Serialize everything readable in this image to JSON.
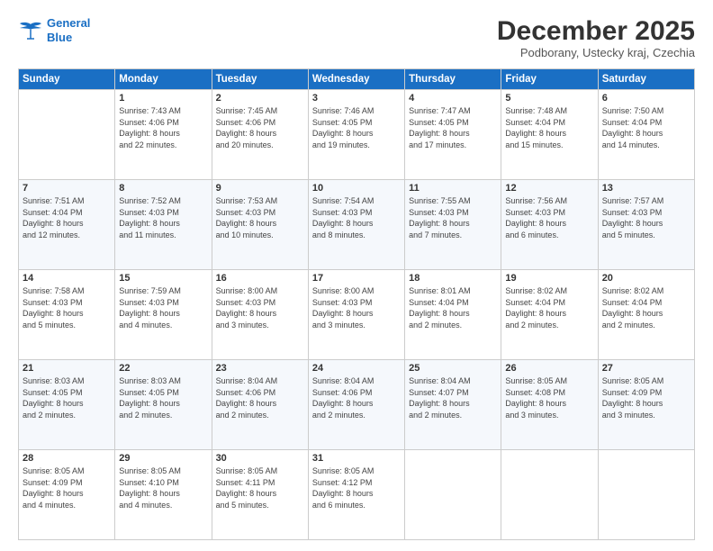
{
  "header": {
    "logo_line1": "General",
    "logo_line2": "Blue",
    "month": "December 2025",
    "location": "Podborany, Ustecky kraj, Czechia"
  },
  "days_of_week": [
    "Sunday",
    "Monday",
    "Tuesday",
    "Wednesday",
    "Thursday",
    "Friday",
    "Saturday"
  ],
  "weeks": [
    [
      {
        "day": "",
        "info": ""
      },
      {
        "day": "1",
        "info": "Sunrise: 7:43 AM\nSunset: 4:06 PM\nDaylight: 8 hours\nand 22 minutes."
      },
      {
        "day": "2",
        "info": "Sunrise: 7:45 AM\nSunset: 4:06 PM\nDaylight: 8 hours\nand 20 minutes."
      },
      {
        "day": "3",
        "info": "Sunrise: 7:46 AM\nSunset: 4:05 PM\nDaylight: 8 hours\nand 19 minutes."
      },
      {
        "day": "4",
        "info": "Sunrise: 7:47 AM\nSunset: 4:05 PM\nDaylight: 8 hours\nand 17 minutes."
      },
      {
        "day": "5",
        "info": "Sunrise: 7:48 AM\nSunset: 4:04 PM\nDaylight: 8 hours\nand 15 minutes."
      },
      {
        "day": "6",
        "info": "Sunrise: 7:50 AM\nSunset: 4:04 PM\nDaylight: 8 hours\nand 14 minutes."
      }
    ],
    [
      {
        "day": "7",
        "info": "Sunrise: 7:51 AM\nSunset: 4:04 PM\nDaylight: 8 hours\nand 12 minutes."
      },
      {
        "day": "8",
        "info": "Sunrise: 7:52 AM\nSunset: 4:03 PM\nDaylight: 8 hours\nand 11 minutes."
      },
      {
        "day": "9",
        "info": "Sunrise: 7:53 AM\nSunset: 4:03 PM\nDaylight: 8 hours\nand 10 minutes."
      },
      {
        "day": "10",
        "info": "Sunrise: 7:54 AM\nSunset: 4:03 PM\nDaylight: 8 hours\nand 8 minutes."
      },
      {
        "day": "11",
        "info": "Sunrise: 7:55 AM\nSunset: 4:03 PM\nDaylight: 8 hours\nand 7 minutes."
      },
      {
        "day": "12",
        "info": "Sunrise: 7:56 AM\nSunset: 4:03 PM\nDaylight: 8 hours\nand 6 minutes."
      },
      {
        "day": "13",
        "info": "Sunrise: 7:57 AM\nSunset: 4:03 PM\nDaylight: 8 hours\nand 5 minutes."
      }
    ],
    [
      {
        "day": "14",
        "info": "Sunrise: 7:58 AM\nSunset: 4:03 PM\nDaylight: 8 hours\nand 5 minutes."
      },
      {
        "day": "15",
        "info": "Sunrise: 7:59 AM\nSunset: 4:03 PM\nDaylight: 8 hours\nand 4 minutes."
      },
      {
        "day": "16",
        "info": "Sunrise: 8:00 AM\nSunset: 4:03 PM\nDaylight: 8 hours\nand 3 minutes."
      },
      {
        "day": "17",
        "info": "Sunrise: 8:00 AM\nSunset: 4:03 PM\nDaylight: 8 hours\nand 3 minutes."
      },
      {
        "day": "18",
        "info": "Sunrise: 8:01 AM\nSunset: 4:04 PM\nDaylight: 8 hours\nand 2 minutes."
      },
      {
        "day": "19",
        "info": "Sunrise: 8:02 AM\nSunset: 4:04 PM\nDaylight: 8 hours\nand 2 minutes."
      },
      {
        "day": "20",
        "info": "Sunrise: 8:02 AM\nSunset: 4:04 PM\nDaylight: 8 hours\nand 2 minutes."
      }
    ],
    [
      {
        "day": "21",
        "info": "Sunrise: 8:03 AM\nSunset: 4:05 PM\nDaylight: 8 hours\nand 2 minutes."
      },
      {
        "day": "22",
        "info": "Sunrise: 8:03 AM\nSunset: 4:05 PM\nDaylight: 8 hours\nand 2 minutes."
      },
      {
        "day": "23",
        "info": "Sunrise: 8:04 AM\nSunset: 4:06 PM\nDaylight: 8 hours\nand 2 minutes."
      },
      {
        "day": "24",
        "info": "Sunrise: 8:04 AM\nSunset: 4:06 PM\nDaylight: 8 hours\nand 2 minutes."
      },
      {
        "day": "25",
        "info": "Sunrise: 8:04 AM\nSunset: 4:07 PM\nDaylight: 8 hours\nand 2 minutes."
      },
      {
        "day": "26",
        "info": "Sunrise: 8:05 AM\nSunset: 4:08 PM\nDaylight: 8 hours\nand 3 minutes."
      },
      {
        "day": "27",
        "info": "Sunrise: 8:05 AM\nSunset: 4:09 PM\nDaylight: 8 hours\nand 3 minutes."
      }
    ],
    [
      {
        "day": "28",
        "info": "Sunrise: 8:05 AM\nSunset: 4:09 PM\nDaylight: 8 hours\nand 4 minutes."
      },
      {
        "day": "29",
        "info": "Sunrise: 8:05 AM\nSunset: 4:10 PM\nDaylight: 8 hours\nand 4 minutes."
      },
      {
        "day": "30",
        "info": "Sunrise: 8:05 AM\nSunset: 4:11 PM\nDaylight: 8 hours\nand 5 minutes."
      },
      {
        "day": "31",
        "info": "Sunrise: 8:05 AM\nSunset: 4:12 PM\nDaylight: 8 hours\nand 6 minutes."
      },
      {
        "day": "",
        "info": ""
      },
      {
        "day": "",
        "info": ""
      },
      {
        "day": "",
        "info": ""
      }
    ]
  ]
}
